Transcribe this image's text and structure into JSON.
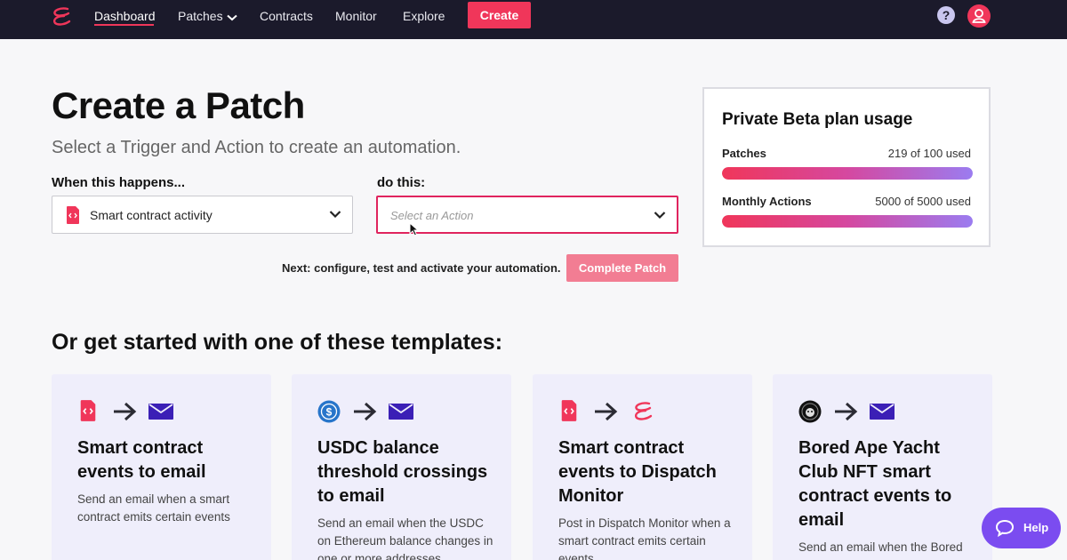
{
  "nav": {
    "items": [
      "Dashboard",
      "Patches",
      "Contracts",
      "Monitor",
      "Explore"
    ],
    "create_label": "Create",
    "help_glyph": "?",
    "brand_color": "#f0365a",
    "bar_color": "#1b1a2b"
  },
  "page": {
    "title": "Create a Patch",
    "subtitle": "Select a Trigger and Action to create an automation."
  },
  "trigger": {
    "label": "When this happens...",
    "value": "Smart contract activity"
  },
  "action": {
    "label": "do this:",
    "placeholder": "Select an Action"
  },
  "footer": {
    "next_text": "Next: configure, test and activate your automation.",
    "complete_label": "Complete Patch"
  },
  "usage": {
    "title": "Private Beta plan usage",
    "rows": [
      {
        "label": "Patches",
        "value": "219 of 100 used",
        "fill": 1.0
      },
      {
        "label": "Monthly Actions",
        "value": "5000 of 5000 used",
        "fill": 1.0
      }
    ]
  },
  "templates": {
    "heading": "Or get started with one of these templates:",
    "cards": [
      {
        "icons": [
          "contract-doc-icon",
          "arrow-right-icon",
          "email-icon"
        ],
        "title": "Smart contract events to email",
        "description": "Send an email when a smart contract emits certain events"
      },
      {
        "icons": [
          "usdc-icon",
          "arrow-right-icon",
          "email-icon"
        ],
        "title": "USDC balance threshold crossings to email",
        "description": "Send an email when the USDC on Ethereum balance changes in one or more addresses"
      },
      {
        "icons": [
          "contract-doc-icon",
          "arrow-right-icon",
          "dispatch-logo-icon"
        ],
        "title": "Smart contract events to Dispatch Monitor",
        "description": "Post in Dispatch Monitor when a smart contract emits certain events"
      },
      {
        "icons": [
          "bayc-icon",
          "arrow-right-icon",
          "email-icon"
        ],
        "title": "Bored Ape Yacht Club NFT smart contract events to email",
        "description": "Send an email when the Bored"
      }
    ]
  },
  "help_fab": {
    "label": "Help"
  }
}
